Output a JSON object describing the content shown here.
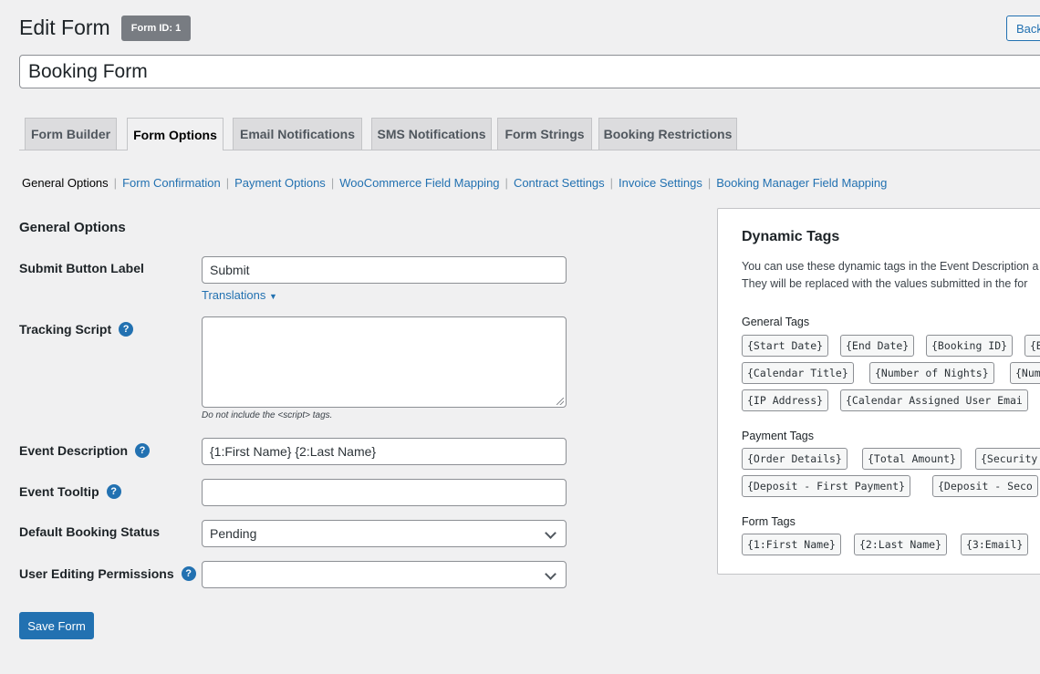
{
  "header": {
    "title": "Edit Form",
    "form_id_badge": "Form ID: 1",
    "back_label": "Back",
    "form_title_value": "Booking Form"
  },
  "tabs": [
    {
      "label": "Form Builder",
      "active": false
    },
    {
      "label": "Form Options",
      "active": true
    },
    {
      "label": "Email Notifications",
      "active": false
    },
    {
      "label": "SMS Notifications",
      "active": false
    },
    {
      "label": "Form Strings",
      "active": false
    },
    {
      "label": "Booking Restrictions",
      "active": false
    }
  ],
  "subnav": [
    {
      "label": "General Options",
      "current": true
    },
    {
      "label": "Form Confirmation",
      "current": false
    },
    {
      "label": "Payment Options",
      "current": false
    },
    {
      "label": "WooCommerce Field Mapping",
      "current": false
    },
    {
      "label": "Contract Settings",
      "current": false
    },
    {
      "label": "Invoice Settings",
      "current": false
    },
    {
      "label": "Booking Manager Field Mapping",
      "current": false
    }
  ],
  "general": {
    "section_title": "General Options",
    "submit_label": "Submit Button Label",
    "submit_value": "Submit",
    "translations_label": "Translations",
    "tracking_label": "Tracking Script",
    "tracking_value": "",
    "tracking_hint": "Do not include the <script> tags.",
    "event_desc_label": "Event Description",
    "event_desc_value": "{1:First Name} {2:Last Name}",
    "event_tooltip_label": "Event Tooltip",
    "event_tooltip_value": "",
    "status_label": "Default Booking Status",
    "status_value": "Pending",
    "permissions_label": "User Editing Permissions",
    "permissions_value": "",
    "save_label": "Save Form"
  },
  "dynamic_tags": {
    "title": "Dynamic Tags",
    "line1": "You can use these dynamic tags in the Event Description a",
    "line2": "They will be replaced with the values submitted in the for",
    "general_label": "General Tags",
    "general": [
      "{Start Date}",
      "{End Date}",
      "{Booking ID}",
      "{B",
      "{Calendar Title}",
      "{Number of Nights}",
      "{Num",
      "{IP Address}",
      "{Calendar Assigned User Emai"
    ],
    "payment_label": "Payment Tags",
    "payment": [
      "{Order Details}",
      "{Total Amount}",
      "{Security",
      "{Deposit - First Payment}",
      "{Deposit - Seco"
    ],
    "form_label": "Form Tags",
    "form": [
      "{1:First Name}",
      "{2:Last Name}",
      "{3:Email}"
    ]
  },
  "icons": {
    "help": "help-icon",
    "select": "chevron-down-icon",
    "translations": "caret-down-icon"
  }
}
